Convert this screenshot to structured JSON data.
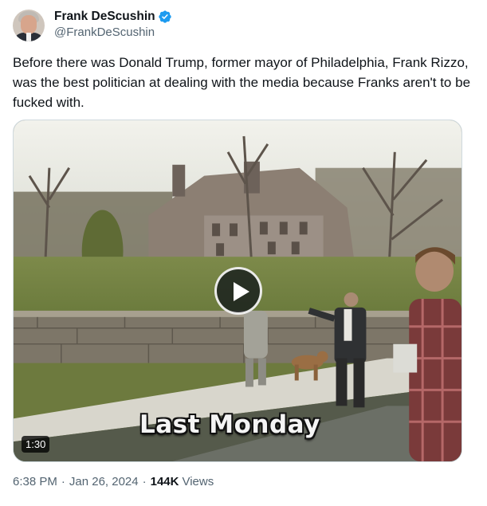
{
  "author": {
    "display_name": "Frank DeScushin",
    "handle": "@FrankDeScushin",
    "verified": true,
    "verified_color": "#1d9bf0",
    "avatar_icon": "avatar-photo-icon"
  },
  "tweet": {
    "text": "Before there was Donald Trump, former mayor of Philadelphia, Frank Rizzo, was the best politician at dealing with the media because Franks aren't to be fucked with."
  },
  "media": {
    "type": "video",
    "caption": "Last Monday",
    "duration": "1:30",
    "play_icon": "play-icon"
  },
  "meta": {
    "time": "6:38 PM",
    "separator": "·",
    "date": "Jan 26, 2024",
    "views_count": "144K",
    "views_label": "Views"
  }
}
